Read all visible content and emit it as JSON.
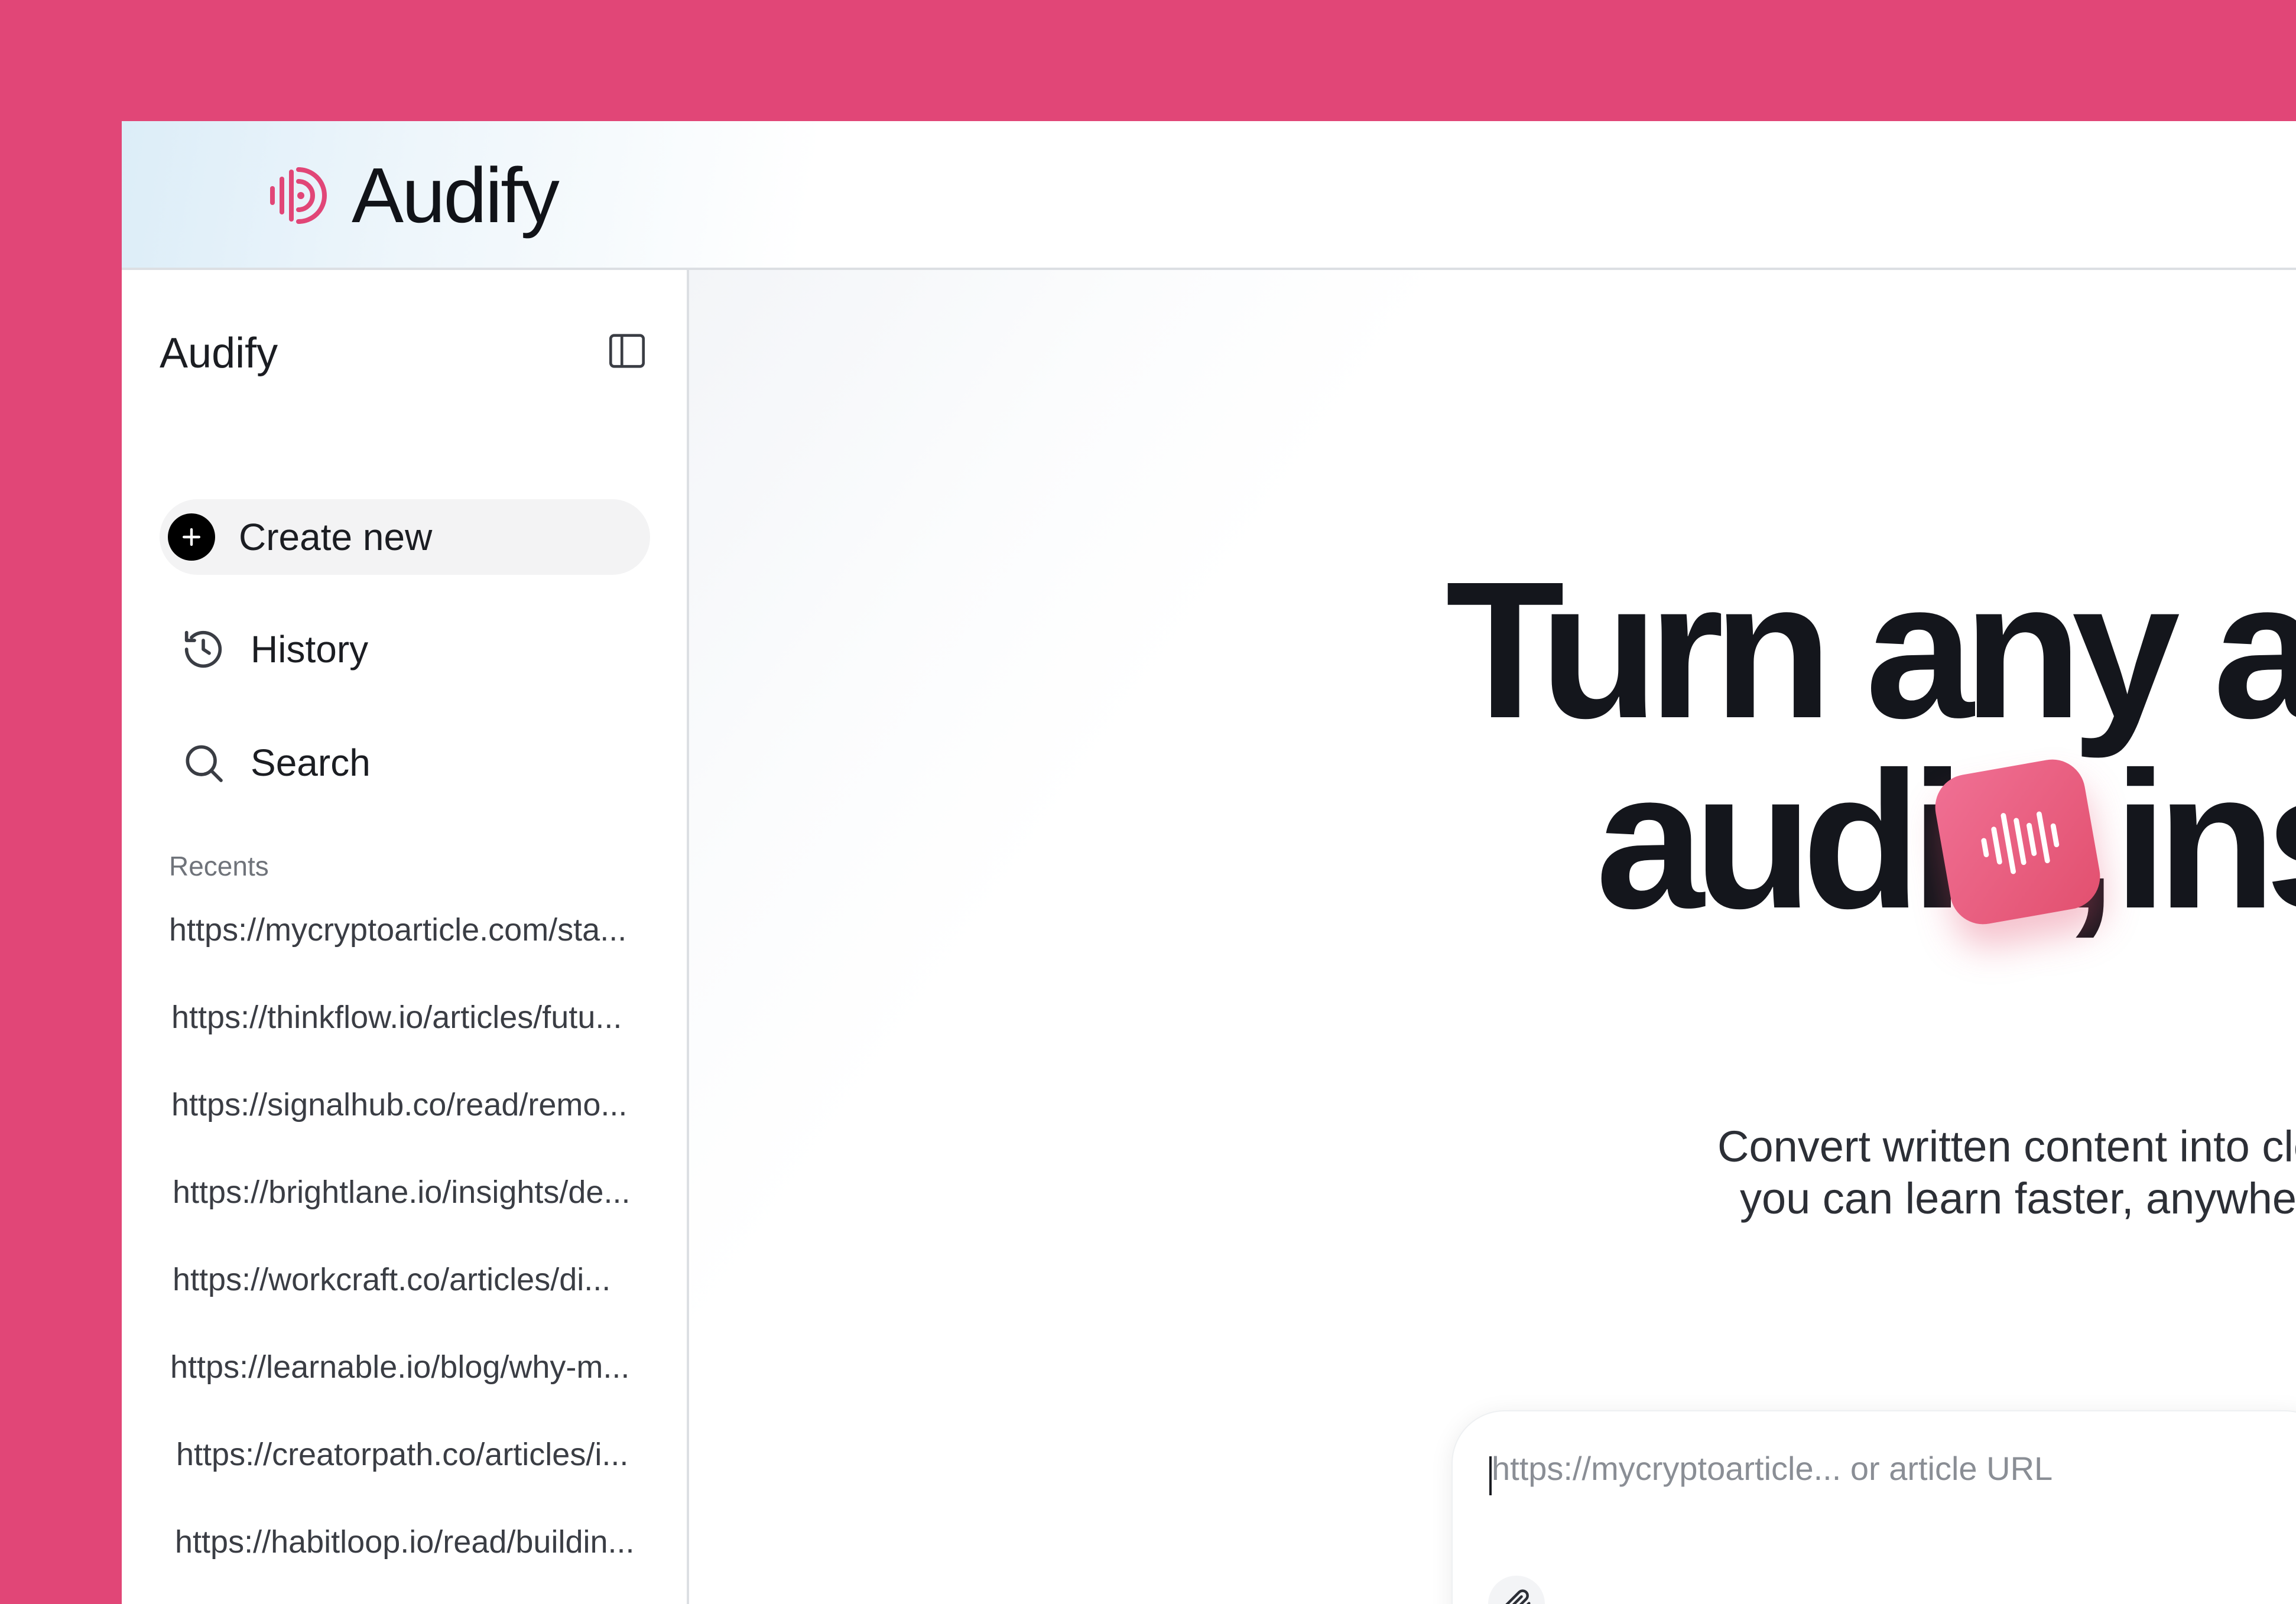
{
  "brand": {
    "name": "Audify",
    "color": "#e14677"
  },
  "sidebar": {
    "title": "Audify",
    "nav": {
      "create_new": "Create new",
      "history": "History",
      "search": "Search"
    },
    "recents_heading": "Recents",
    "recents": [
      "https://mycryptoarticle.com/sta...",
      "https://thinkflow.io/articles/futu...",
      "https://signalhub.co/read/remo...",
      "https://brightlane.io/insights/de...",
      "https://workcraft.co/articles/di...",
      "https://learnable.io/blog/why-m...",
      "https://creatorpath.co/articles/i...",
      "https://habitloop.io/read/buildin..."
    ]
  },
  "hero": {
    "line1": "Turn any artic",
    "line2a": "audio,",
    "line2b": "ins",
    "sub1": "Convert written content into clear, natu",
    "sub2": "you can learn faster, anywhere, witho"
  },
  "input": {
    "placeholder": "https://mycryptoarticle... or article URL",
    "value": ""
  },
  "icons": {
    "brand_logo": "audio-wave-logo-icon",
    "sidebar_toggle": "sidebar-toggle-icon",
    "create": "plus-icon",
    "history": "history-icon",
    "search": "search-icon",
    "badge": "audio-wave-icon",
    "attach": "paperclip-icon"
  }
}
